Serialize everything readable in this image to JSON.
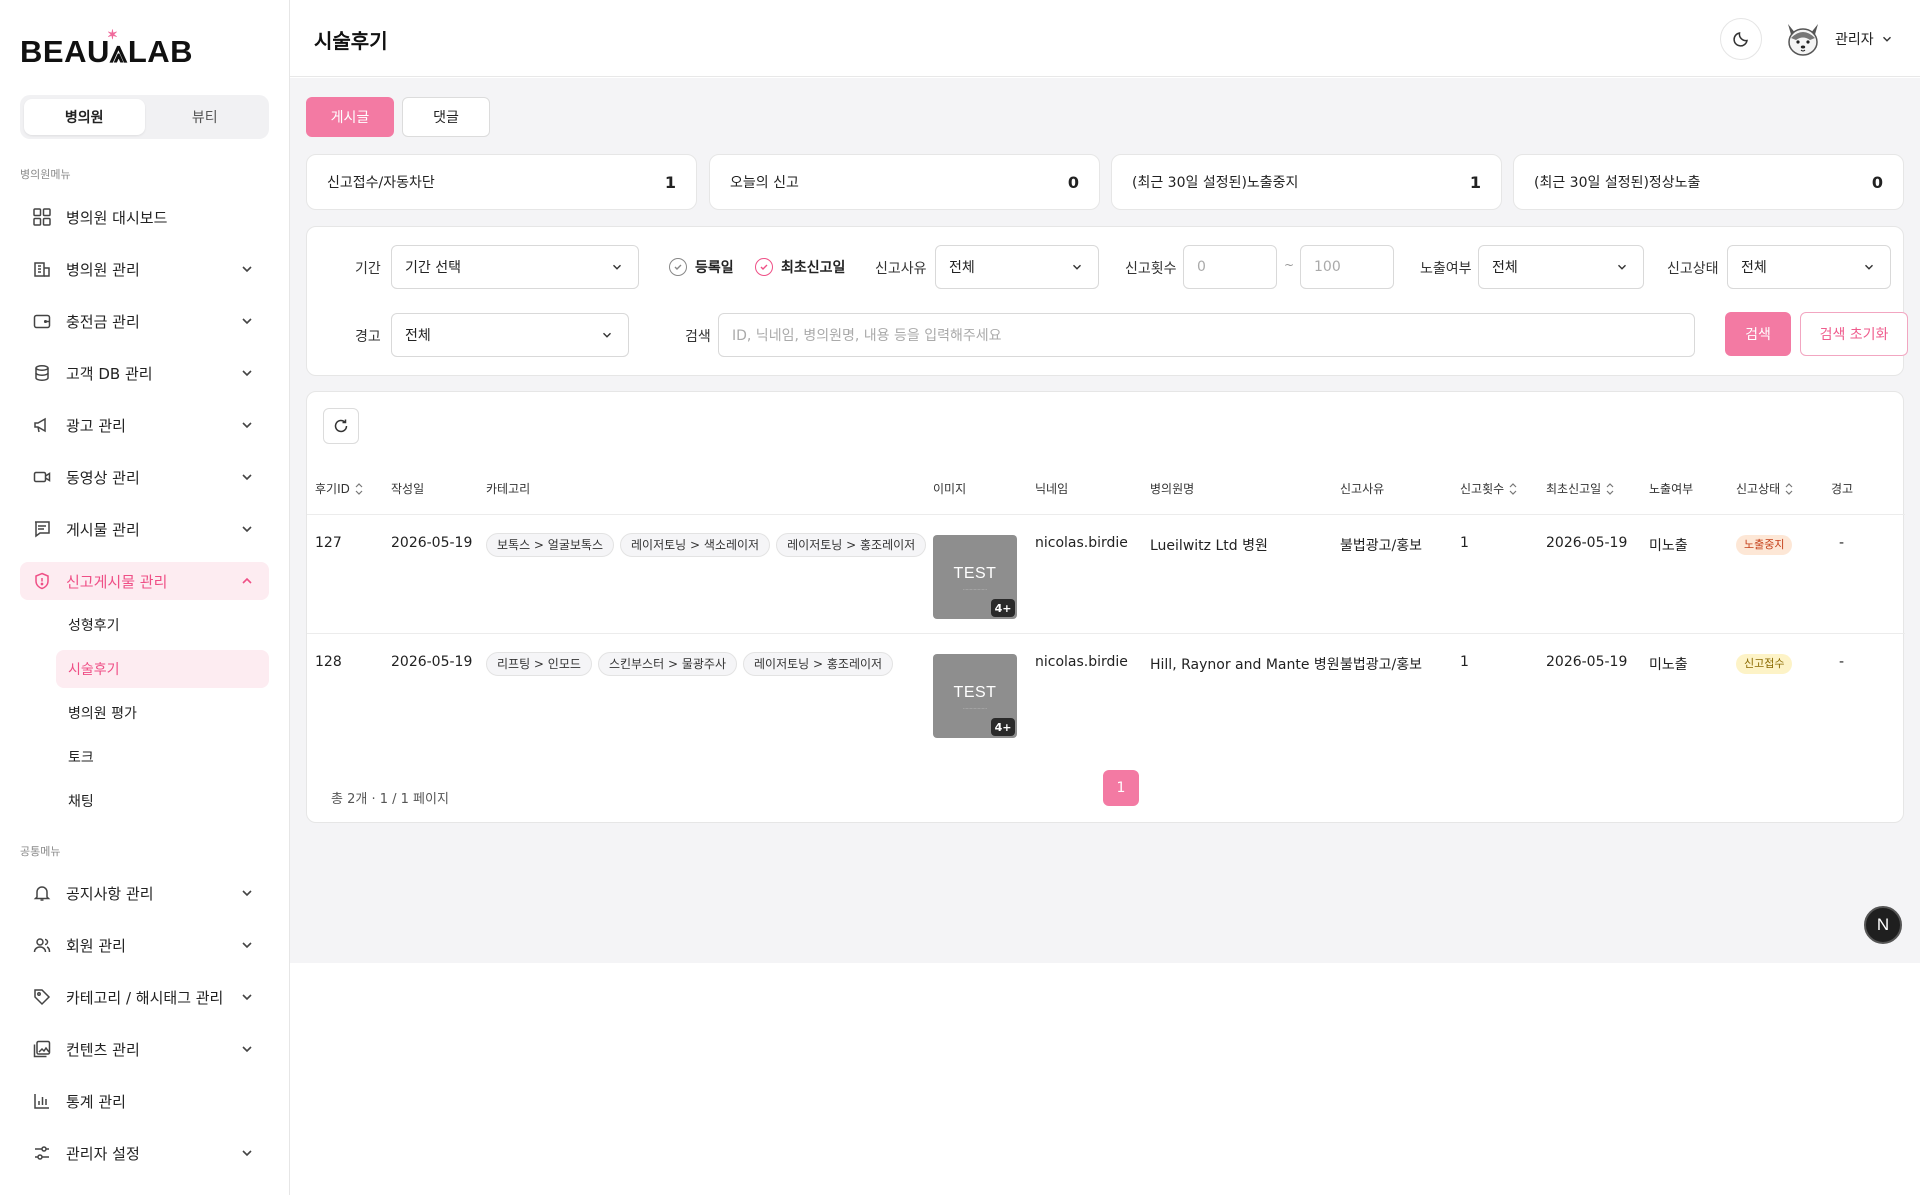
{
  "brand": {
    "logo_text": "BEAUTYLAB",
    "logo_display": "BEAU⩓LAB",
    "accent_color": "#f37aa3"
  },
  "sidebar": {
    "segment": [
      "병의원",
      "뷰티"
    ],
    "segment_active": "병의원",
    "section_hospital": "병의원메뉴",
    "section_common": "공통메뉴",
    "hospital_items": [
      {
        "label": "병의원 대시보드",
        "icon": "grid-icon"
      },
      {
        "label": "병의원 관리",
        "icon": "building-icon"
      },
      {
        "label": "충전금 관리",
        "icon": "wallet-icon"
      },
      {
        "label": "고객 DB 관리",
        "icon": "database-icon"
      },
      {
        "label": "광고 관리",
        "icon": "megaphone-icon"
      },
      {
        "label": "동영상 관리",
        "icon": "video-icon"
      },
      {
        "label": "게시물 관리",
        "icon": "post-icon"
      },
      {
        "label": "신고게시물 관리",
        "icon": "shield-alert-icon"
      }
    ],
    "report_sub": [
      "성형후기",
      "시술후기",
      "병의원 평가",
      "토크",
      "채팅"
    ],
    "report_sub_active": "시술후기",
    "common_items": [
      {
        "label": "공지사항 관리",
        "icon": "bell-icon"
      },
      {
        "label": "회원 관리",
        "icon": "users-icon"
      },
      {
        "label": "카테고리 / 해시태그 관리",
        "icon": "tag-icon"
      },
      {
        "label": "컨텐츠 관리",
        "icon": "images-icon"
      },
      {
        "label": "통계 관리",
        "icon": "bar-chart-icon"
      },
      {
        "label": "관리자 설정",
        "icon": "sliders-icon"
      }
    ]
  },
  "header": {
    "title": "시술후기",
    "admin_name": "관리자"
  },
  "tabs": [
    "게시글",
    "댓글"
  ],
  "stats": [
    {
      "label": "신고접수/자동차단",
      "value": "1"
    },
    {
      "label": "오늘의 신고",
      "value": "0"
    },
    {
      "label": "(최근 30일 설정된)노출중지",
      "value": "1"
    },
    {
      "label": "(최근 30일 설정된)정상노출",
      "value": "0"
    }
  ],
  "filters": {
    "period_label": "기간",
    "period_value": "기간 선택",
    "radio_reg": "등록일",
    "radio_first": "최초신고일",
    "reason_label": "신고사유",
    "reason_value": "전체",
    "count_label": "신고횟수",
    "count_min_placeholder": "0",
    "count_sep": "~",
    "count_max_placeholder": "100",
    "exposure_label": "노출여부",
    "exposure_value": "전체",
    "status_label": "신고상태",
    "status_value": "전체",
    "warning_label": "경고",
    "warning_value": "전체",
    "search_label": "검색",
    "search_placeholder": "ID, 닉네임, 병의원명, 내용 등을 입력해주세요",
    "search_button": "검색",
    "reset_button": "검색 초기화"
  },
  "table": {
    "headers": [
      "후기ID",
      "작성일",
      "카테고리",
      "이미지",
      "닉네임",
      "병의원명",
      "신고사유",
      "신고횟수",
      "최초신고일",
      "노출여부",
      "신고상태",
      "경고"
    ],
    "rows": [
      {
        "id": "127",
        "date": "2026-05-19",
        "categories": [
          "보톡스 > 얼굴보톡스",
          "레이저토닝 > 색소레이저",
          "레이저토닝 > 홍조레이저"
        ],
        "image_title": "TEST",
        "image_more": "4+",
        "nickname": "nicolas.birdie",
        "hospital": "Lueilwitz Ltd 병원",
        "reason": "불법광고/홍보",
        "count": "1",
        "first_report": "2026-05-19",
        "exposure": "미노출",
        "status": "노출중지",
        "warning": "-"
      },
      {
        "id": "128",
        "date": "2026-05-19",
        "categories": [
          "리프팅 > 인모드",
          "스킨부스터 > 물광주사",
          "레이저토닝 > 홍조레이저"
        ],
        "image_title": "TEST",
        "image_more": "4+",
        "nickname": "nicolas.birdie",
        "hospital": "Hill, Raynor and Mante 병원",
        "reason": "불법광고/홍보",
        "count": "1",
        "first_report": "2026-05-19",
        "exposure": "미노출",
        "status": "신고접수",
        "warning": "-"
      }
    ],
    "summary": "총 2개 · 1 / 1 페이지",
    "page": "1"
  },
  "floating": {
    "label": "N"
  }
}
